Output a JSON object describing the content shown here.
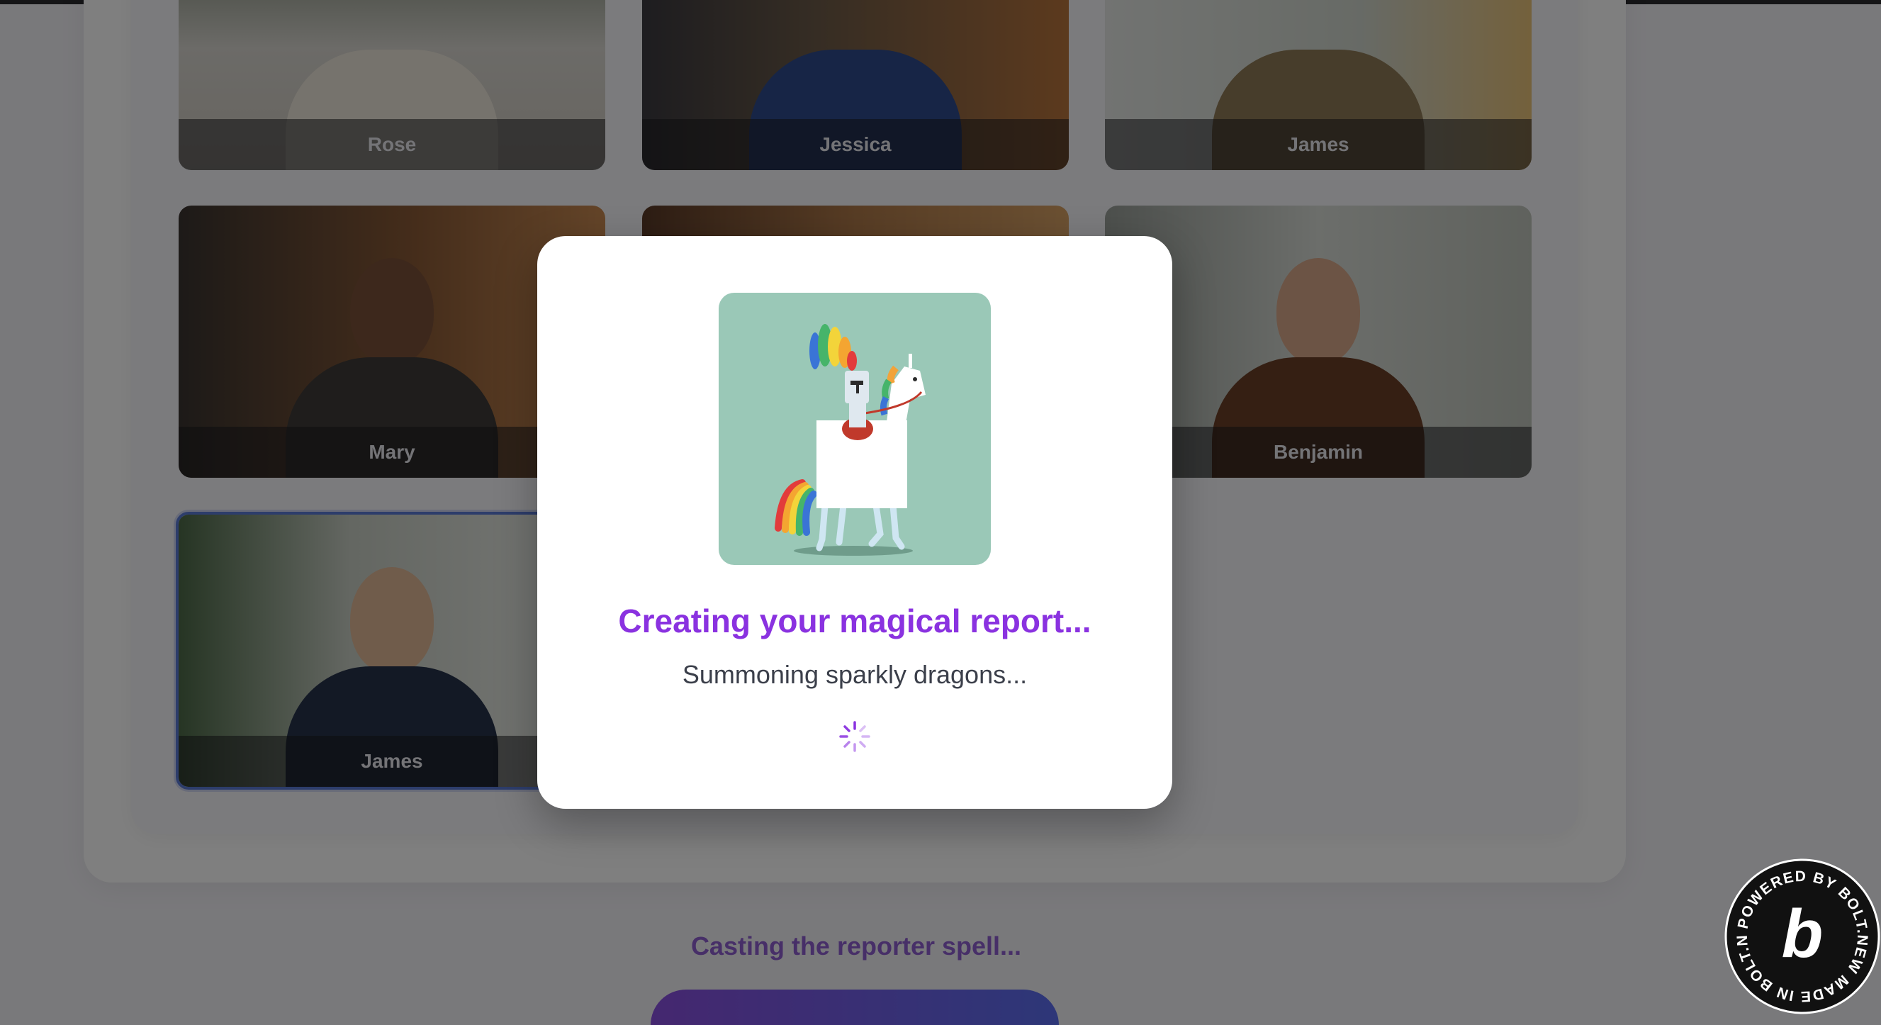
{
  "reporters": [
    {
      "name": "Rose",
      "selected": false
    },
    {
      "name": "Jessica",
      "selected": false
    },
    {
      "name": "James",
      "selected": false
    },
    {
      "name": "Mary",
      "selected": false
    },
    {
      "name": "",
      "selected": false
    },
    {
      "name": "Benjamin",
      "selected": false
    },
    {
      "name": "James",
      "selected": true
    }
  ],
  "status_text": "Casting the reporter spell...",
  "generate_button_label": "",
  "modal": {
    "title": "Creating your magical report...",
    "subtitle": "Summoning sparkly dragons...",
    "illustration_icon": "unicorn-knight-illustration",
    "spinner_icon": "loading-spinner-icon"
  },
  "badge": {
    "ring_text": "POWERED BY BOLT.NEW MADE IN BOLT.NEW",
    "glyph": "b"
  },
  "colors": {
    "accent_purple": "#8a32e0",
    "status_purple": "#8e5fd0",
    "selected_border": "#5a7bd6",
    "illustration_bg": "#9ac8b7"
  }
}
